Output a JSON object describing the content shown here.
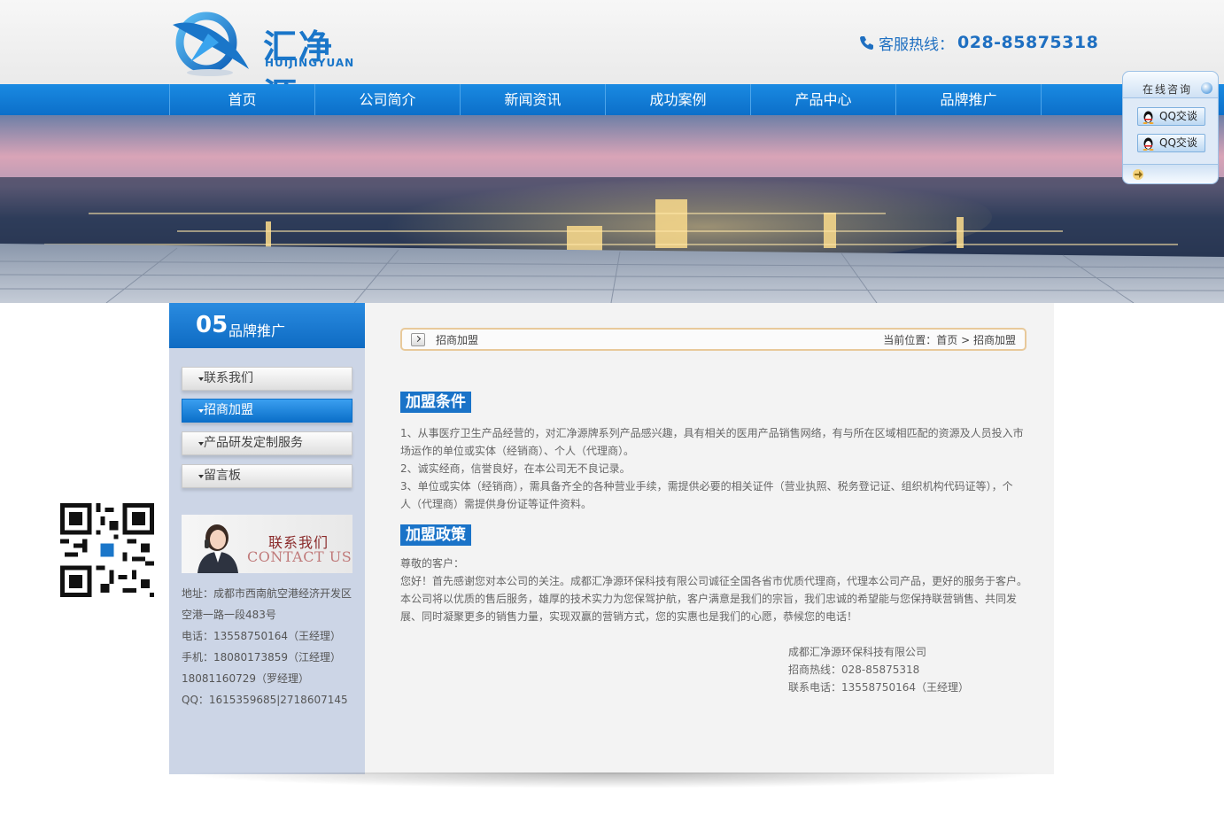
{
  "brand": {
    "name_cn": "汇净源",
    "name_en": "HUIJINGYUAN",
    "hotline_label": "客服热线：",
    "hotline_number": "028-85875318"
  },
  "nav": {
    "items": [
      {
        "label": "首页"
      },
      {
        "label": "公司简介"
      },
      {
        "label": "新闻资讯"
      },
      {
        "label": "成功案例"
      },
      {
        "label": "产品中心"
      },
      {
        "label": "品牌推广"
      }
    ]
  },
  "qq_float": {
    "title": "在线咨询",
    "buttons": [
      {
        "label": "QQ交谈"
      },
      {
        "label": "QQ交谈"
      }
    ]
  },
  "sidebar": {
    "number": "05",
    "title": "品牌推广",
    "menu": [
      {
        "label": "联系我们",
        "active": false
      },
      {
        "label": "招商加盟",
        "active": true
      },
      {
        "label": "产品研发定制服务",
        "active": false
      },
      {
        "label": "留言板",
        "active": false
      }
    ],
    "contact_banner": {
      "cn": "联系我们",
      "en": "CONTACT US"
    },
    "contact_lines": [
      "地址：成都市西南航空港经济开发区",
      "空港一路一段483号",
      "电话：13558750164（王经理）",
      "手机：18080173859（江经理）",
      "18081160729（罗经理）",
      "QQ：1615359685|2718607145"
    ]
  },
  "breadcrumb": {
    "title": "招商加盟",
    "prefix": "当前位置：",
    "home": "首页",
    "separator": ">",
    "current": "招商加盟"
  },
  "content": {
    "section1_title": "加盟条件",
    "section1_lines": [
      "1、从事医疗卫生产品经营的，对汇净源牌系列产品感兴趣，具有相关的医用产品销售网络，有与所在区域相匹配的资源及人员投入市",
      "场运作的单位或实体（经销商）、个人（代理商）。",
      "2、诚实经商，信誉良好，在本公司无不良记录。",
      "3、单位或实体（经销商），需具备齐全的各种营业手续，需提供必要的相关证件（营业执照、税务登记证、组织机构代码证等），个",
      "人（代理商）需提供身份证等证件资料。"
    ],
    "section2_title": "加盟政策",
    "section2_lines": [
      "尊敬的客户：",
      "您好！首先感谢您对本公司的关注。成都汇净源环保科技有限公司诚征全国各省市优质代理商，代理本公司产品，更好的服务于客户。",
      "本公司将以优质的售后服务，雄厚的技术实力为您保驾护航，客户满意是我们的宗旨，我们忠诚的希望能与您保持联营销售、共同发",
      "展、同时凝聚更多的销售力量，实现双赢的营销方式，您的实惠也是我们的心愿，恭候您的电话！"
    ],
    "signature": [
      "成都汇净源环保科技有限公司",
      "招商热线：028-85875318",
      "联系电话：13558750164（王经理）"
    ]
  },
  "colors": {
    "brand_blue": "#1a76c9",
    "nav_blue": "#0c6fc9",
    "sidebar_bg": "#ccd5e6",
    "main_bg": "#f3f3f3"
  }
}
